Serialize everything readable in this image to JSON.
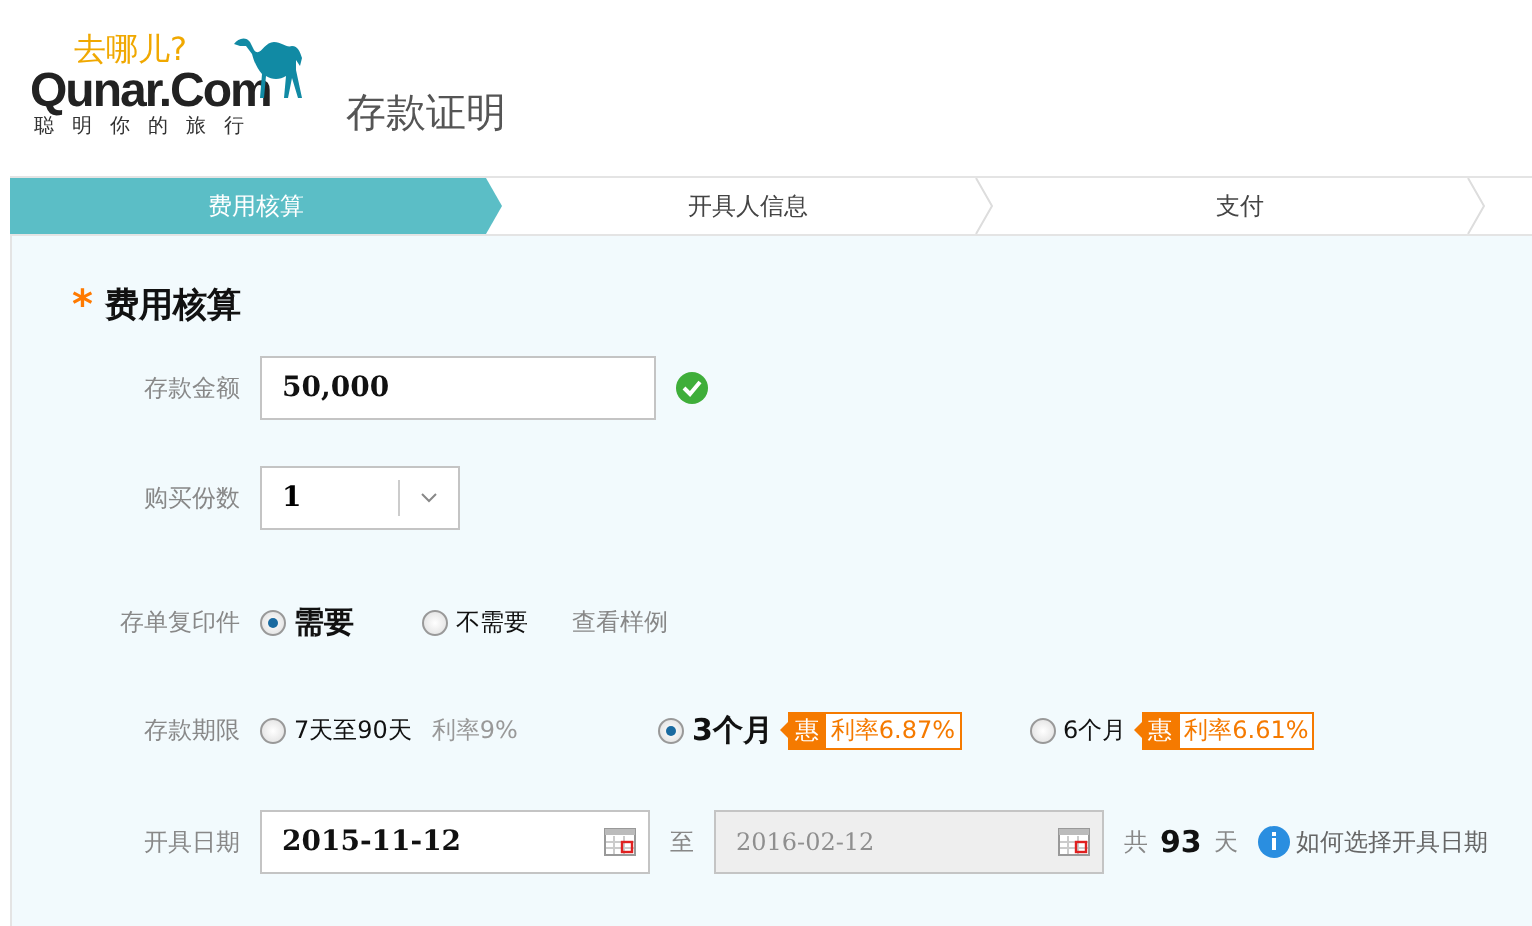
{
  "logo": {
    "tagline": "去哪儿?",
    "brand": "Qunar.Com",
    "slogan": "聪明你的旅行"
  },
  "page_title": "存款证明",
  "steps": [
    {
      "label": "费用核算",
      "selected": true
    },
    {
      "label": "开具人信息",
      "selected": false
    },
    {
      "label": "支付",
      "selected": false
    }
  ],
  "section": {
    "required_mark": "*",
    "title": "费用核算"
  },
  "amount": {
    "label": "存款金额",
    "value": "50,000",
    "valid": true
  },
  "copies": {
    "label": "购买份数",
    "value": "1"
  },
  "photocopy": {
    "label": "存单复印件",
    "options": [
      {
        "label": "需要",
        "selected": true
      },
      {
        "label": "不需要",
        "selected": false
      }
    ],
    "link": "查看样例"
  },
  "term": {
    "label": "存款期限",
    "options": [
      {
        "kind": "plain",
        "label": "7天至90天",
        "rate": "利率9%",
        "selected": false
      },
      {
        "kind": "promo",
        "label": "3个月",
        "badge": "惠",
        "rate": "利率6.87%",
        "selected": true
      },
      {
        "kind": "promo",
        "label": "6个月",
        "badge": "惠",
        "rate": "利率6.61%",
        "selected": false
      }
    ]
  },
  "date": {
    "label": "开具日期",
    "start": "2015-11-12",
    "separator": "至",
    "end": "2016-02-12",
    "end_disabled": true,
    "total_prefix": "共",
    "days": "93",
    "unit": "天",
    "help": "如何选择开具日期"
  }
}
